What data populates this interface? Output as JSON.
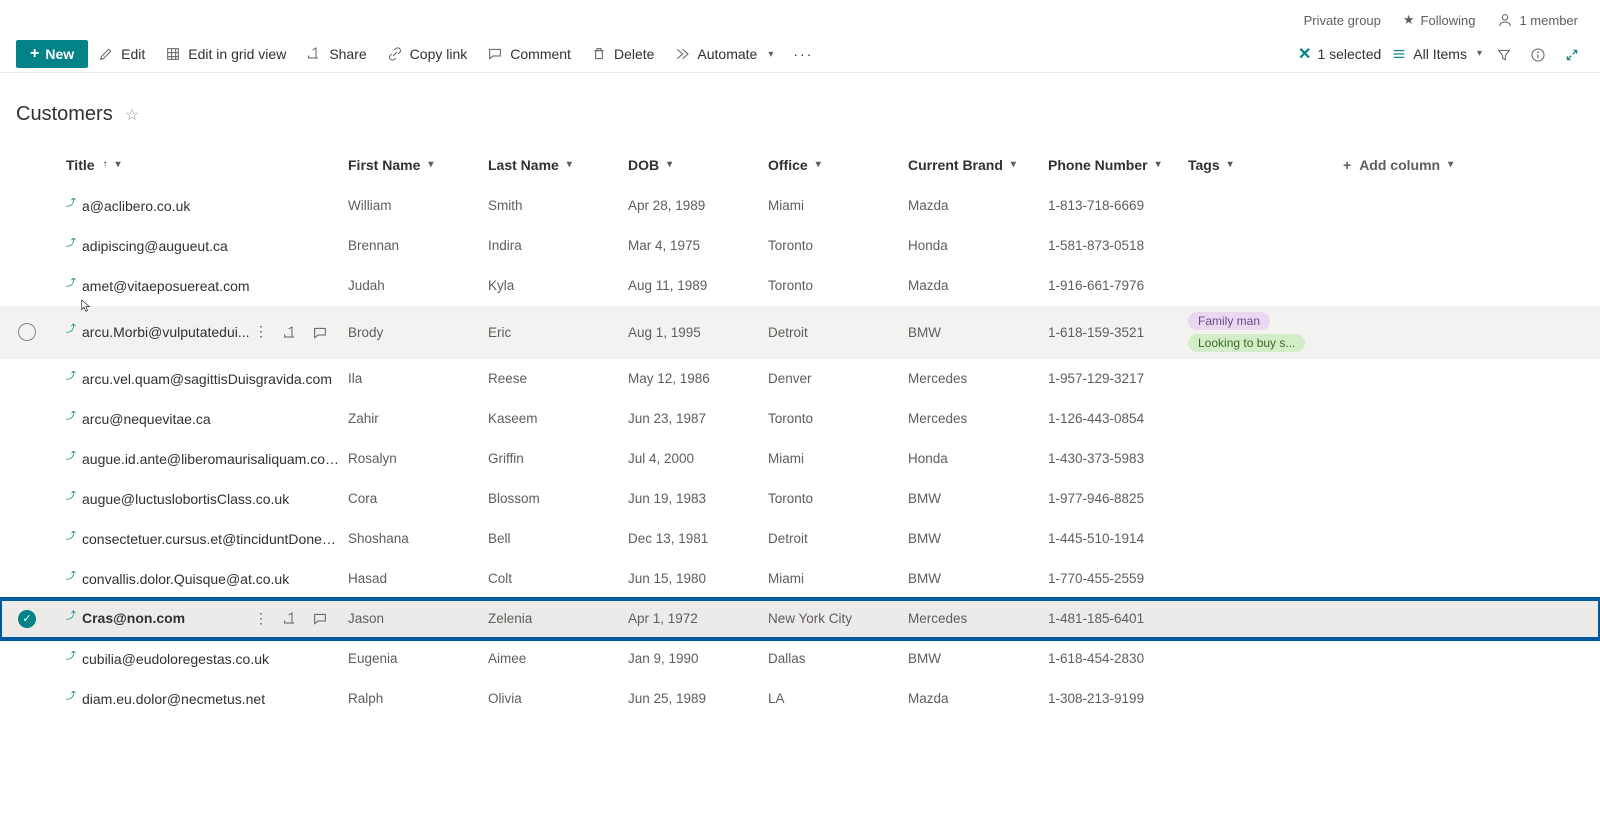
{
  "topbar": {
    "privacy": "Private group",
    "following": "Following",
    "members": "1 member"
  },
  "commands": {
    "new": "New",
    "edit": "Edit",
    "edit_grid": "Edit in grid view",
    "share": "Share",
    "copy_link": "Copy link",
    "comment": "Comment",
    "delete": "Delete",
    "automate": "Automate"
  },
  "toolbar_right": {
    "selected_count": "1 selected",
    "view_name": "All Items"
  },
  "list": {
    "title": "Customers"
  },
  "columns": {
    "title": "Title",
    "first_name": "First Name",
    "last_name": "Last Name",
    "dob": "DOB",
    "office": "Office",
    "current_brand": "Current Brand",
    "phone": "Phone Number",
    "tags": "Tags",
    "add_column": "Add column"
  },
  "rows": [
    {
      "title": "a@aclibero.co.uk",
      "fn": "William",
      "ln": "Smith",
      "dob": "Apr 28, 1989",
      "office": "Miami",
      "brand": "Mazda",
      "phone": "1-813-718-6669",
      "tags": [],
      "state": ""
    },
    {
      "title": "adipiscing@augueut.ca",
      "fn": "Brennan",
      "ln": "Indira",
      "dob": "Mar 4, 1975",
      "office": "Toronto",
      "brand": "Honda",
      "phone": "1-581-873-0518",
      "tags": [],
      "state": ""
    },
    {
      "title": "amet@vitaeposuereat.com",
      "fn": "Judah",
      "ln": "Kyla",
      "dob": "Aug 11, 1989",
      "office": "Toronto",
      "brand": "Mazda",
      "phone": "1-916-661-7976",
      "tags": [],
      "state": ""
    },
    {
      "title": "arcu.Morbi@vulputatedui...",
      "fn": "Brody",
      "ln": "Eric",
      "dob": "Aug 1, 1995",
      "office": "Detroit",
      "brand": "BMW",
      "phone": "1-618-159-3521",
      "tags": [
        {
          "text": "Family man",
          "color": "purple"
        },
        {
          "text": "Looking to buy s...",
          "color": "green"
        }
      ],
      "state": "hover"
    },
    {
      "title": "arcu.vel.quam@sagittisDuisgravida.com",
      "fn": "Ila",
      "ln": "Reese",
      "dob": "May 12, 1986",
      "office": "Denver",
      "brand": "Mercedes",
      "phone": "1-957-129-3217",
      "tags": [],
      "state": ""
    },
    {
      "title": "arcu@nequevitae.ca",
      "fn": "Zahir",
      "ln": "Kaseem",
      "dob": "Jun 23, 1987",
      "office": "Toronto",
      "brand": "Mercedes",
      "phone": "1-126-443-0854",
      "tags": [],
      "state": ""
    },
    {
      "title": "augue.id.ante@liberomaurisaliquam.co.uk",
      "fn": "Rosalyn",
      "ln": "Griffin",
      "dob": "Jul 4, 2000",
      "office": "Miami",
      "brand": "Honda",
      "phone": "1-430-373-5983",
      "tags": [],
      "state": ""
    },
    {
      "title": "augue@luctuslobortisClass.co.uk",
      "fn": "Cora",
      "ln": "Blossom",
      "dob": "Jun 19, 1983",
      "office": "Toronto",
      "brand": "BMW",
      "phone": "1-977-946-8825",
      "tags": [],
      "state": ""
    },
    {
      "title": "consectetuer.cursus.et@tinciduntDonec.co.uk",
      "fn": "Shoshana",
      "ln": "Bell",
      "dob": "Dec 13, 1981",
      "office": "Detroit",
      "brand": "BMW",
      "phone": "1-445-510-1914",
      "tags": [],
      "state": ""
    },
    {
      "title": "convallis.dolor.Quisque@at.co.uk",
      "fn": "Hasad",
      "ln": "Colt",
      "dob": "Jun 15, 1980",
      "office": "Miami",
      "brand": "BMW",
      "phone": "1-770-455-2559",
      "tags": [],
      "state": ""
    },
    {
      "title": "Cras@non.com",
      "fn": "Jason",
      "ln": "Zelenia",
      "dob": "Apr 1, 1972",
      "office": "New York City",
      "brand": "Mercedes",
      "phone": "1-481-185-6401",
      "tags": [],
      "state": "selected highlight"
    },
    {
      "title": "cubilia@eudoloregestas.co.uk",
      "fn": "Eugenia",
      "ln": "Aimee",
      "dob": "Jan 9, 1990",
      "office": "Dallas",
      "brand": "BMW",
      "phone": "1-618-454-2830",
      "tags": [],
      "state": ""
    },
    {
      "title": "diam.eu.dolor@necmetus.net",
      "fn": "Ralph",
      "ln": "Olivia",
      "dob": "Jun 25, 1989",
      "office": "LA",
      "brand": "Mazda",
      "phone": "1-308-213-9199",
      "tags": [],
      "state": ""
    }
  ]
}
